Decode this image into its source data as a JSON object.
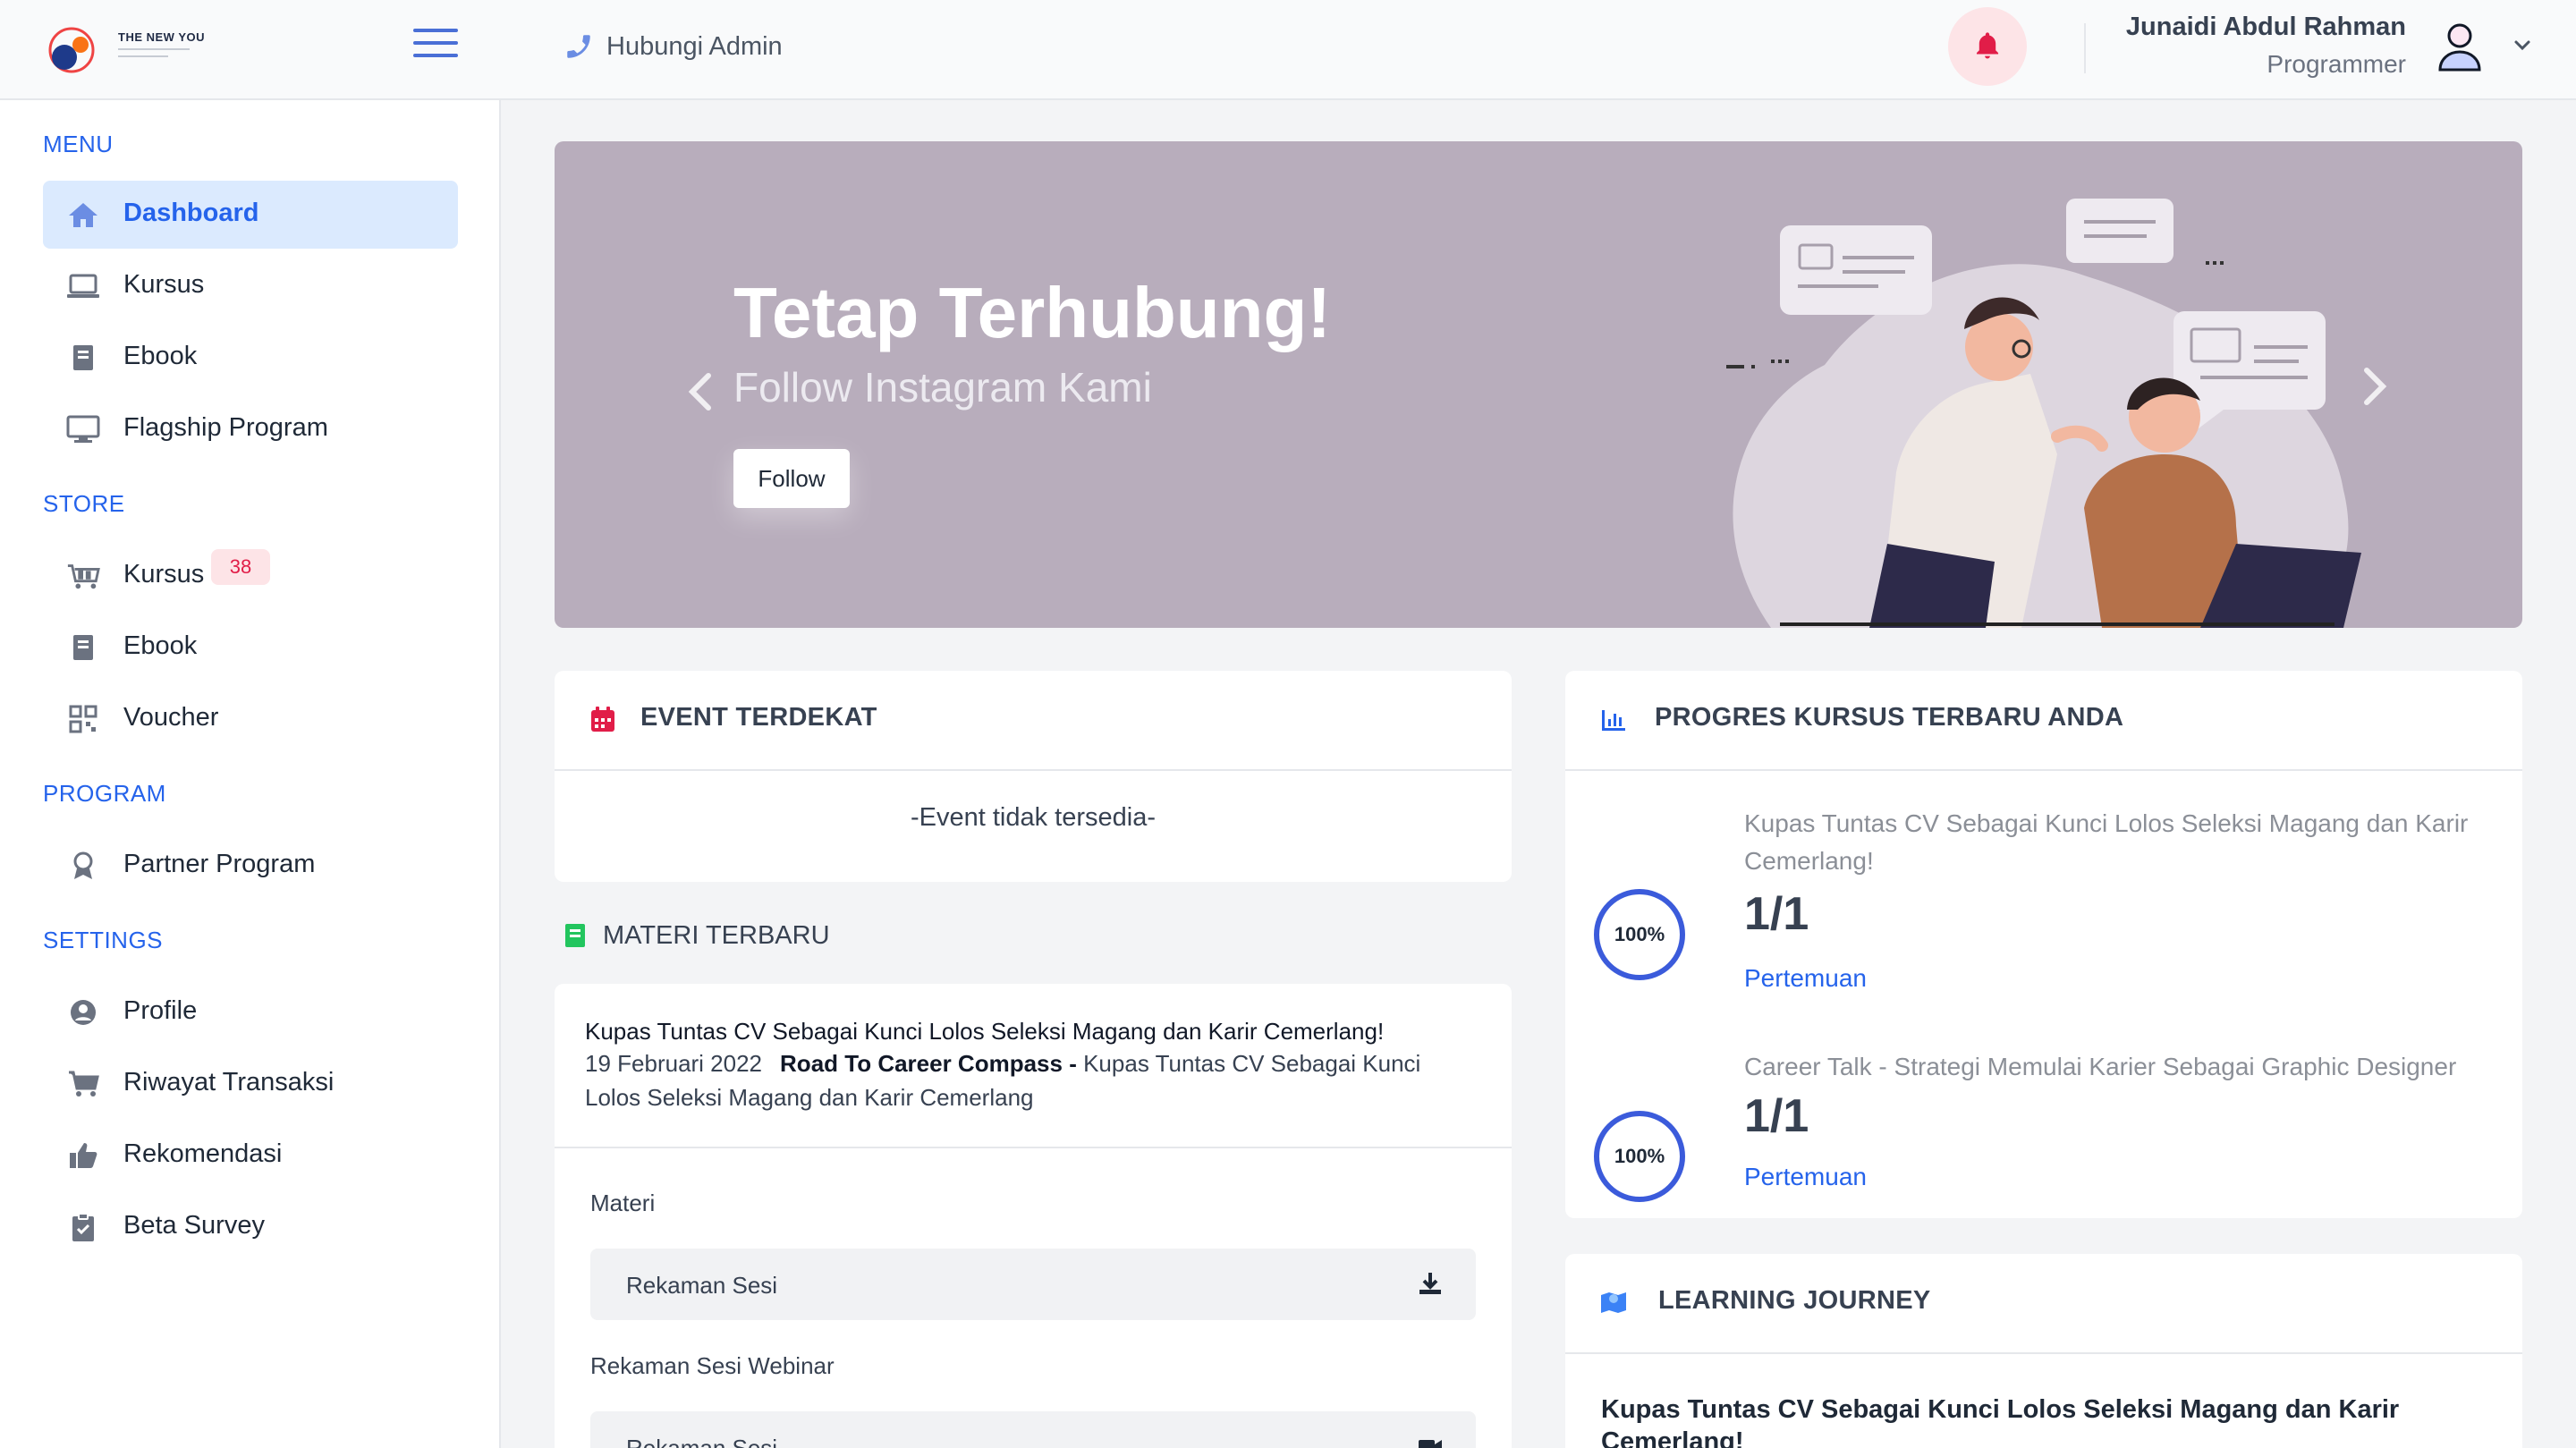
{
  "header": {
    "logo_text": "THE NEW YOU",
    "contact_label": "Hubungi Admin",
    "user_name": "Junaidi Abdul Rahman",
    "user_role": "Programmer"
  },
  "sidebar": {
    "sections": [
      {
        "title": "MENU",
        "items": [
          {
            "label": "Dashboard",
            "icon": "home-icon",
            "active": true
          },
          {
            "label": "Kursus",
            "icon": "laptop-icon"
          },
          {
            "label": "Ebook",
            "icon": "book-icon"
          },
          {
            "label": "Flagship Program",
            "icon": "monitor-icon"
          }
        ]
      },
      {
        "title": "STORE",
        "items": [
          {
            "label": "Kursus",
            "icon": "cart-store-icon",
            "badge": "38"
          },
          {
            "label": "Ebook",
            "icon": "book-icon"
          },
          {
            "label": "Voucher",
            "icon": "qr-icon"
          }
        ]
      },
      {
        "title": "PROGRAM",
        "items": [
          {
            "label": "Partner Program",
            "icon": "award-icon"
          }
        ]
      },
      {
        "title": "SETTINGS",
        "items": [
          {
            "label": "Profile",
            "icon": "user-circle-icon"
          },
          {
            "label": "Riwayat Transaksi",
            "icon": "cart-icon"
          },
          {
            "label": "Rekomendasi",
            "icon": "thumbs-up-icon"
          },
          {
            "label": "Beta Survey",
            "icon": "clipboard-icon"
          }
        ]
      }
    ]
  },
  "hero": {
    "title": "Tetap Terhubung!",
    "subtitle": "Follow Instagram Kami",
    "button": "Follow"
  },
  "event": {
    "title": "EVENT TERDEKAT",
    "empty": "-Event tidak tersedia-"
  },
  "materi": {
    "title": "MATERI TERBARU",
    "course_title": "Kupas Tuntas CV Sebagai Kunci Lolos Seleksi Magang dan Karir Cemerlang!",
    "date": "19 Februari 2022",
    "program": "Road To Career Compass -",
    "desc_part1": "Kupas Tuntas CV Sebagai Kunci",
    "desc_part2": "Lolos Seleksi Magang dan Karir Cemerlang",
    "section1_label": "Materi",
    "section1_item": "Rekaman Sesi",
    "section2_label": "Rekaman Sesi Webinar",
    "section2_item": "Rekaman Sesi"
  },
  "progress": {
    "title": "PROGRES KURSUS TERBARU ANDA",
    "items": [
      {
        "title": "Kupas Tuntas CV Sebagai Kunci Lolos Seleksi Magang dan Karir Cemerlang!",
        "percent_label": "100%",
        "percent": 100,
        "fraction": "1/1",
        "link": "Pertemuan"
      },
      {
        "title": "Career Talk - Strategi Memulai Karier Sebagai Graphic Designer",
        "percent_label": "100%",
        "percent": 100,
        "fraction": "1/1",
        "link": "Pertemuan"
      }
    ]
  },
  "journey": {
    "title": "LEARNING JOURNEY",
    "course": "Kupas Tuntas CV Sebagai Kunci Lolos Seleksi Magang dan Karir Cemerlang!"
  },
  "colors": {
    "accent": "#2563eb",
    "hero_bg": "#b8adbc",
    "alert": "#e11d48",
    "badge_bg": "#fde4e7"
  }
}
